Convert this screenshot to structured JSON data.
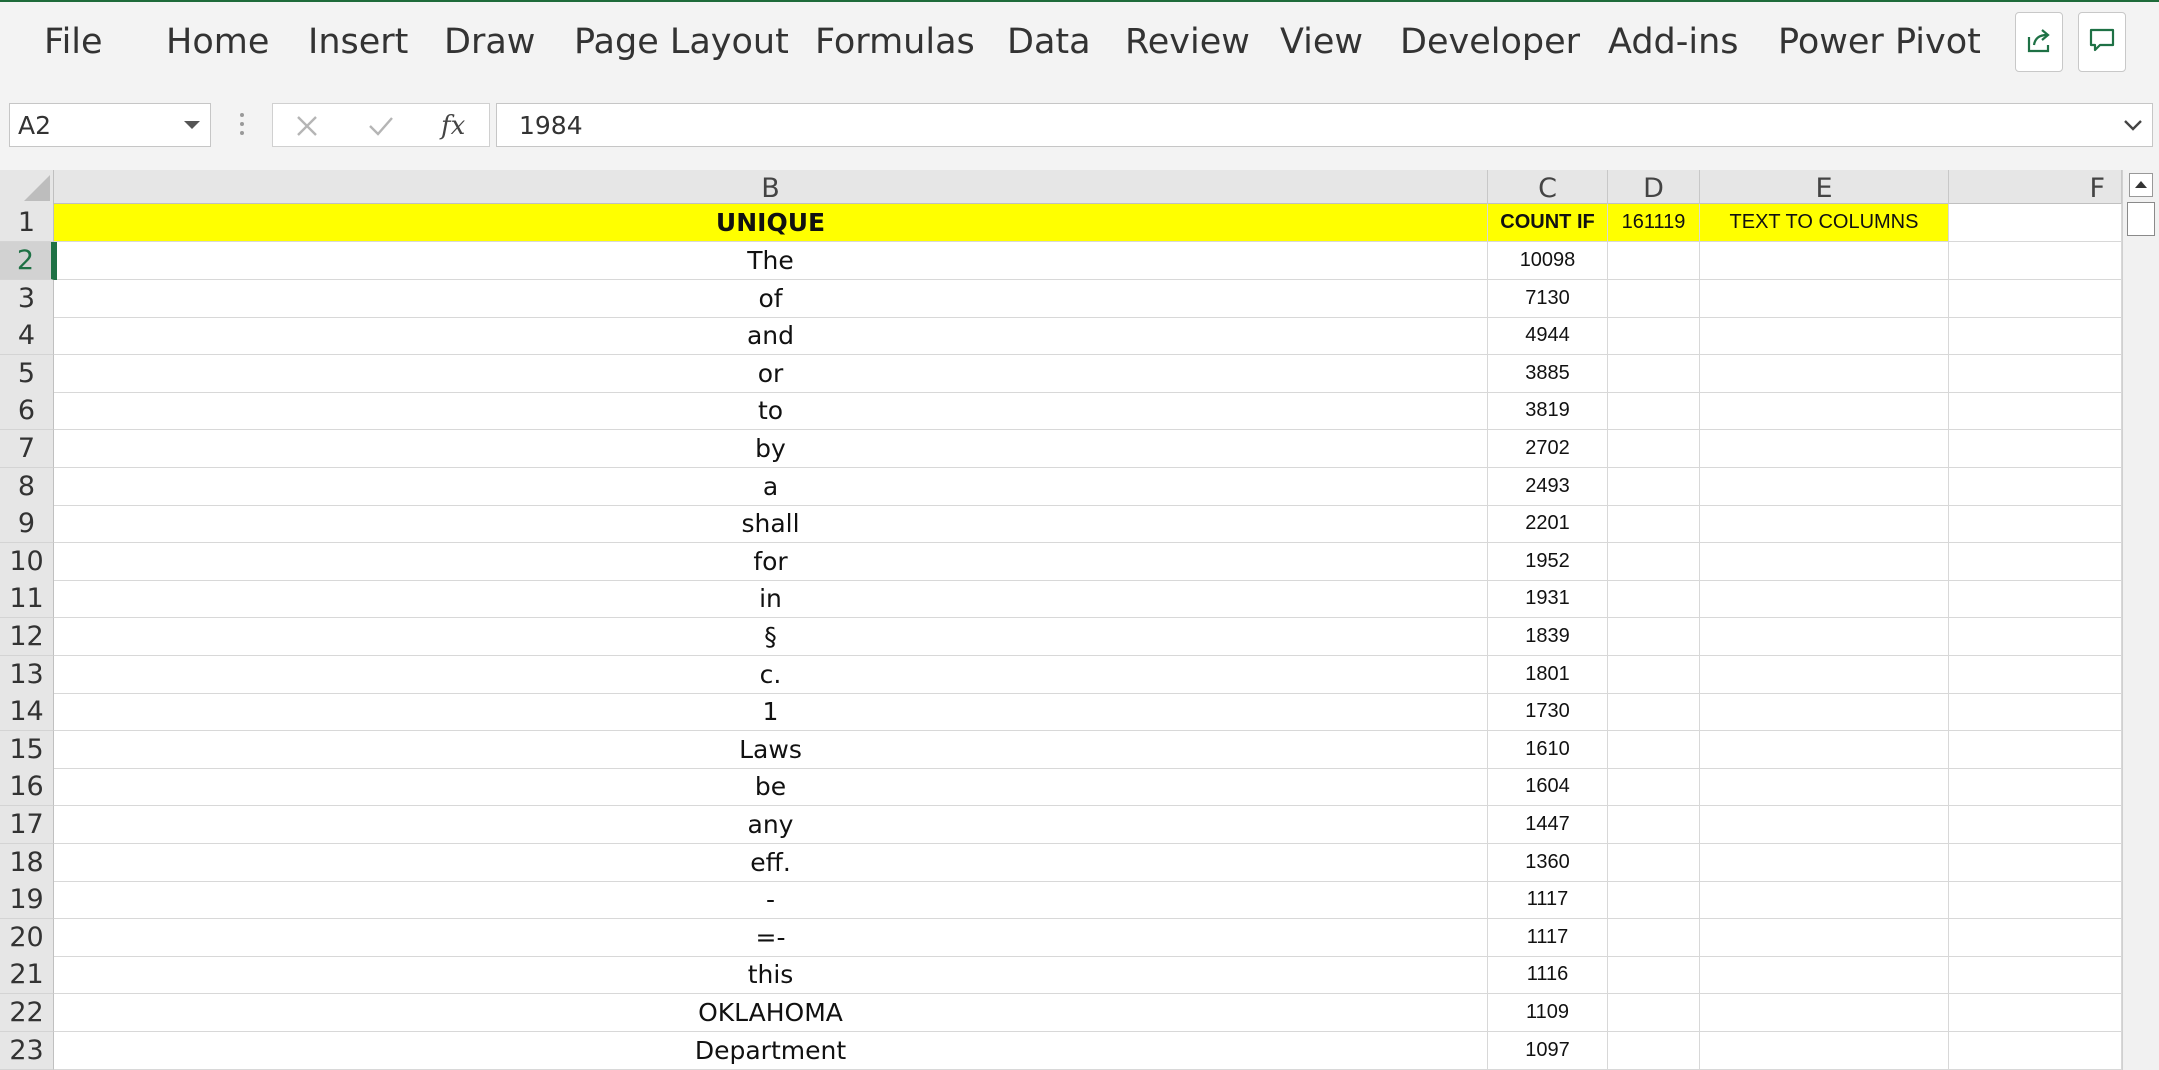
{
  "ribbon": {
    "tabs": [
      {
        "label": "File"
      },
      {
        "label": "Home"
      },
      {
        "label": "Insert"
      },
      {
        "label": "Draw"
      },
      {
        "label": "Page Layout"
      },
      {
        "label": "Formulas"
      },
      {
        "label": "Data"
      },
      {
        "label": "Review"
      },
      {
        "label": "View"
      },
      {
        "label": "Developer"
      },
      {
        "label": "Add-ins"
      },
      {
        "label": "Power Pivot"
      }
    ],
    "icons": {
      "share": "share-icon",
      "comment": "comment-icon"
    },
    "accent_color": "#1e7145"
  },
  "formula_bar": {
    "name_box": "A2",
    "formula": "1984",
    "icons": [
      "more-options-icon",
      "cancel-icon",
      "enter-icon",
      "fx-icon",
      "expand-icon"
    ]
  },
  "sheet": {
    "columns": [
      "B",
      "C",
      "D",
      "E",
      "F"
    ],
    "header_row": {
      "row": "1",
      "B": "UNIQUE",
      "C": "COUNT IF",
      "D": "161119",
      "E": "TEXT TO COLUMNS",
      "fill": "#ffff00"
    },
    "rows": [
      {
        "row": "2",
        "B": "The",
        "C": "10098"
      },
      {
        "row": "3",
        "B": "of",
        "C": "7130"
      },
      {
        "row": "4",
        "B": "and",
        "C": "4944"
      },
      {
        "row": "5",
        "B": "or",
        "C": "3885"
      },
      {
        "row": "6",
        "B": "to",
        "C": "3819"
      },
      {
        "row": "7",
        "B": "by",
        "C": "2702"
      },
      {
        "row": "8",
        "B": "a",
        "C": "2493"
      },
      {
        "row": "9",
        "B": "shall",
        "C": "2201"
      },
      {
        "row": "10",
        "B": "for",
        "C": "1952"
      },
      {
        "row": "11",
        "B": "in",
        "C": "1931"
      },
      {
        "row": "12",
        "B": "§",
        "C": "1839"
      },
      {
        "row": "13",
        "B": "c.",
        "C": "1801"
      },
      {
        "row": "14",
        "B": "1",
        "C": "1730"
      },
      {
        "row": "15",
        "B": "Laws",
        "C": "1610"
      },
      {
        "row": "16",
        "B": "be",
        "C": "1604"
      },
      {
        "row": "17",
        "B": "any",
        "C": "1447"
      },
      {
        "row": "18",
        "B": "eff.",
        "C": "1360"
      },
      {
        "row": "19",
        "B": "-",
        "C": "1117"
      },
      {
        "row": "20",
        "B": "=-",
        "C": "1117"
      },
      {
        "row": "21",
        "B": "this",
        "C": "1116"
      },
      {
        "row": "22",
        "B": "OKLAHOMA",
        "C": "1109"
      },
      {
        "row": "23",
        "B": "Department",
        "C": "1097"
      }
    ],
    "active_row": "2"
  }
}
